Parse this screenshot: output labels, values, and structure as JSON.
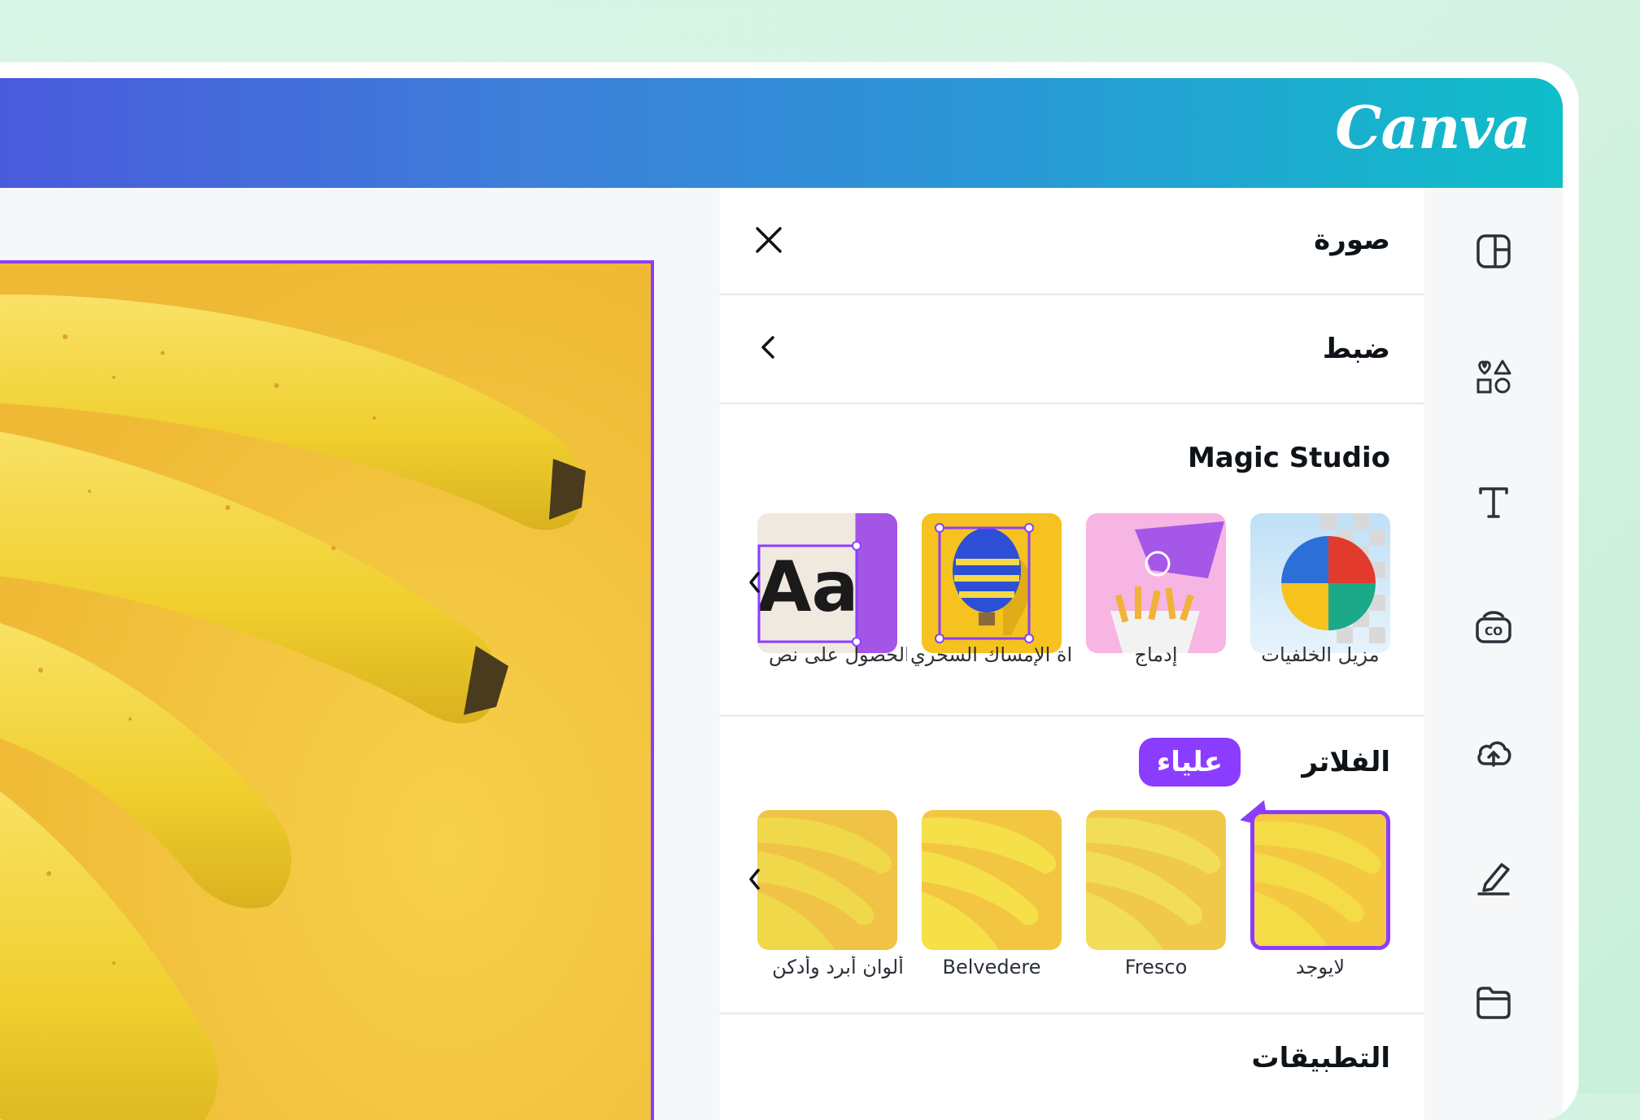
{
  "app": {
    "logo": "Canva"
  },
  "panel": {
    "header_title": "صورة",
    "adjust_label": "ضبط",
    "magic_studio": {
      "title": "Magic Studio",
      "items": [
        {
          "label": "مزيل الخلفيات"
        },
        {
          "label": "إدماج"
        },
        {
          "label": "أداة الإمساك السحري"
        },
        {
          "label": "الحصول على نص"
        }
      ]
    },
    "filters": {
      "title": "الفلاتر",
      "items": [
        {
          "label": "لايوجد",
          "selected": true
        },
        {
          "label": "Fresco"
        },
        {
          "label": "Belvedere"
        },
        {
          "label": "ألوان أبرد وأدكن"
        }
      ]
    },
    "apps_title": "التطبيقات",
    "collaborator_tooltip": "علياء"
  },
  "rail": {
    "icons": [
      "templates-icon",
      "elements-icon",
      "text-icon",
      "brand-icon",
      "uploads-icon",
      "draw-icon",
      "projects-icon"
    ]
  },
  "colors": {
    "accent": "#8b3dff",
    "banana_bg": "#f5c842",
    "topbar_start": "#4b58dc",
    "topbar_end": "#0fbec9"
  }
}
